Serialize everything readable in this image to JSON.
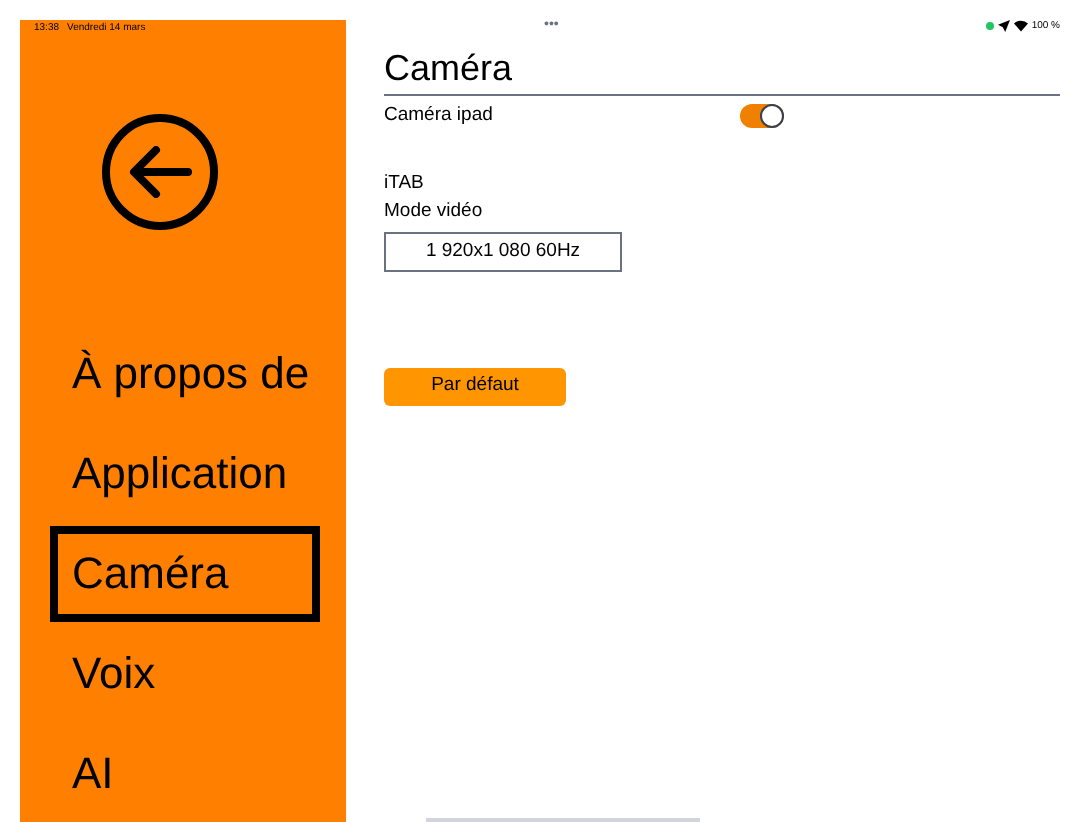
{
  "status_bar": {
    "time": "13:38",
    "date": "Vendredi 14 mars",
    "dots": "•••",
    "battery": "100 %"
  },
  "sidebar": {
    "items": [
      {
        "label": "À propos de",
        "selected": false
      },
      {
        "label": "Application",
        "selected": false
      },
      {
        "label": "Caméra",
        "selected": true
      },
      {
        "label": "Voix",
        "selected": false
      },
      {
        "label": "AI",
        "selected": false
      }
    ]
  },
  "page": {
    "title": "Caméra",
    "camera_toggle": {
      "label": "Caméra ipad",
      "on": true
    },
    "device": "iTAB",
    "video_mode": {
      "label": "Mode vidéo",
      "value": "1 920x1 080 60Hz"
    },
    "default_button": "Par défaut"
  }
}
